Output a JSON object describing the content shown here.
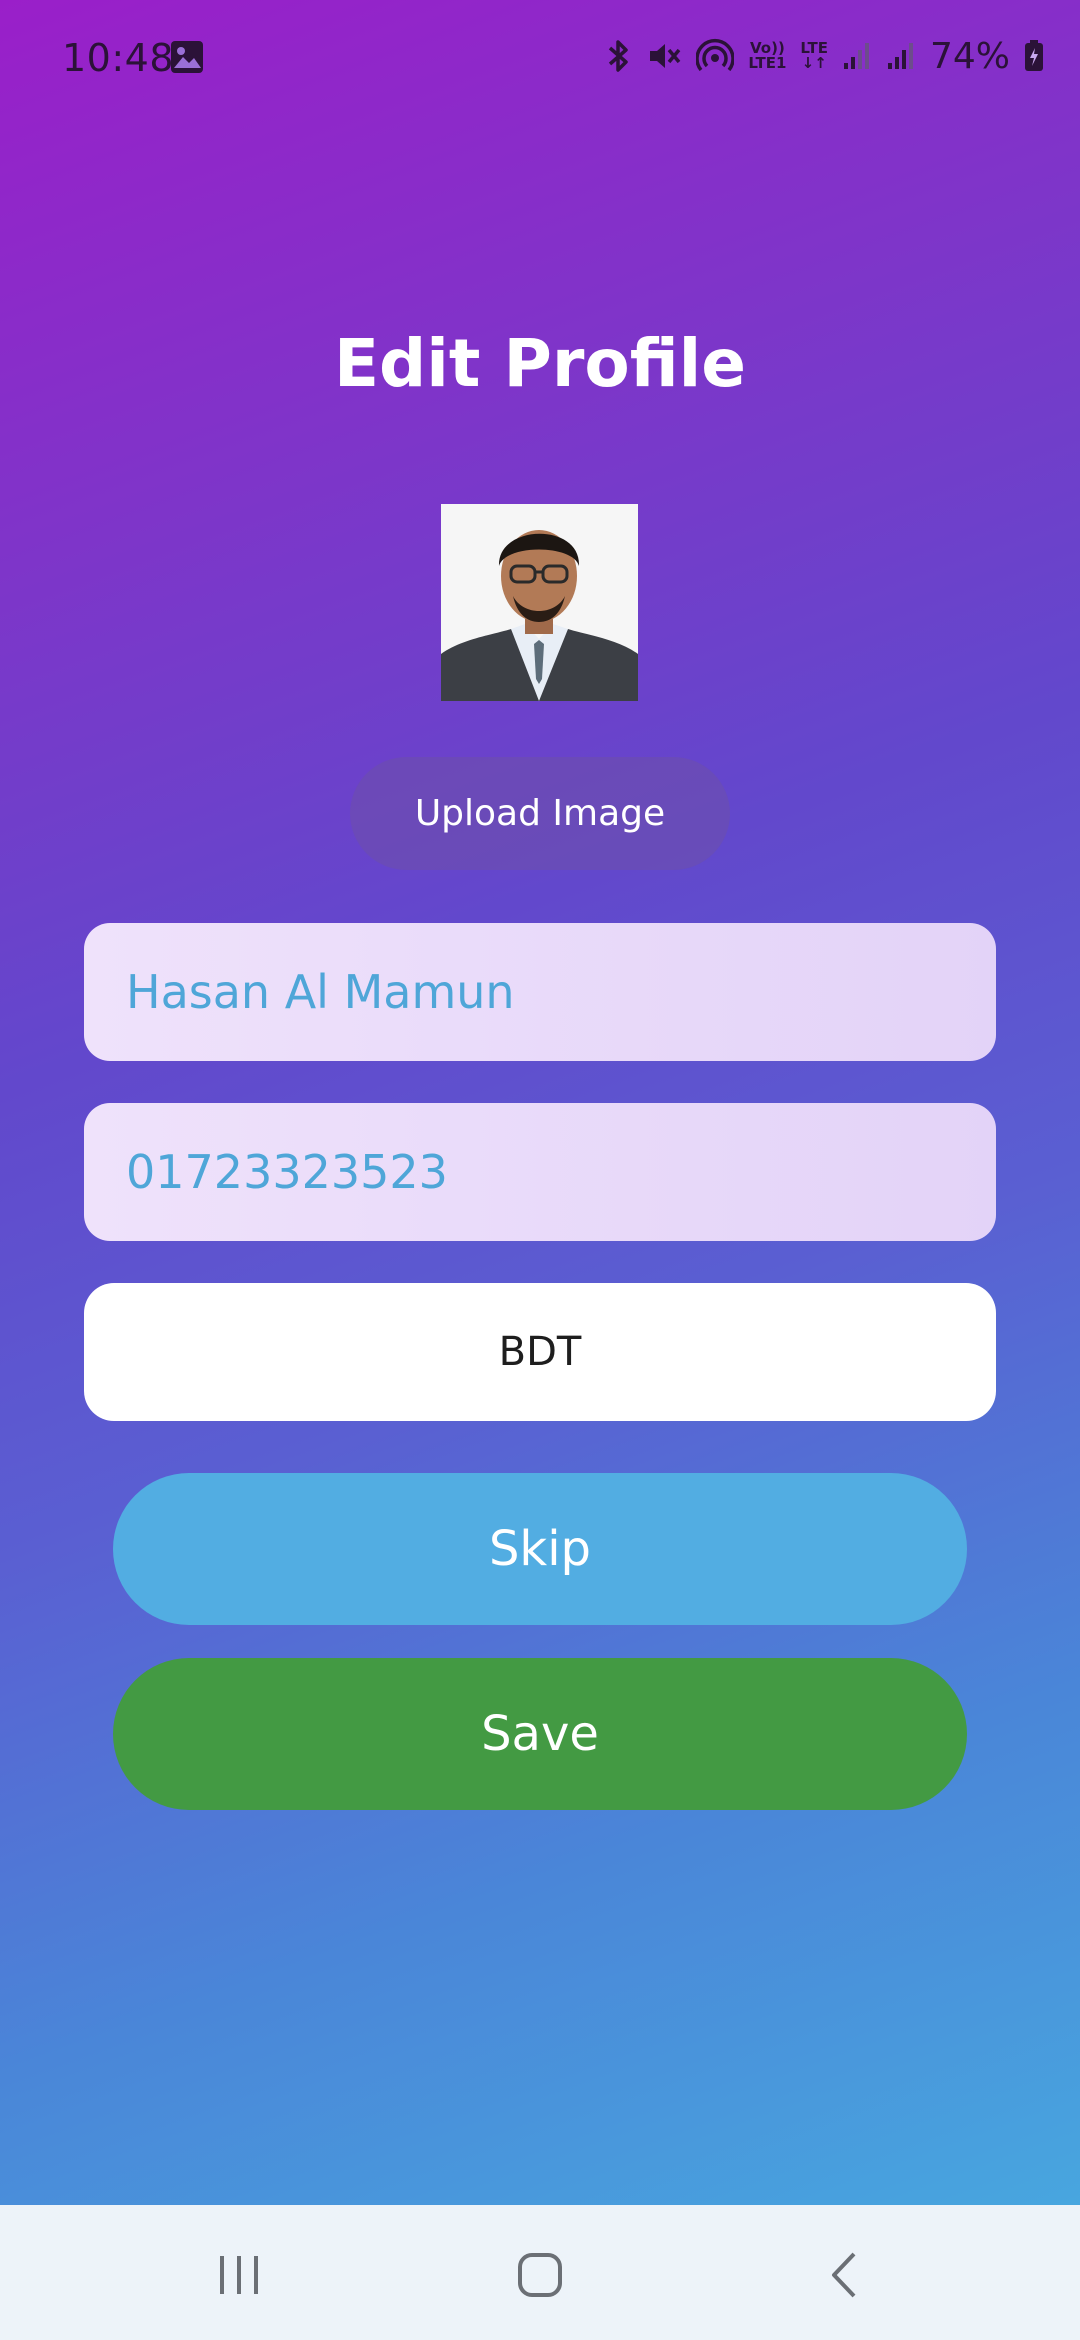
{
  "status_bar": {
    "time": "10:48",
    "volte_line1": "Vo))",
    "volte_line2": "LTE1",
    "lte_label": "LTE",
    "battery": "74%",
    "icons": [
      "gallery-icon",
      "bluetooth-icon",
      "mute-icon",
      "hotspot-icon",
      "volte-icon",
      "lte-data-icon",
      "signal-icon",
      "signal-icon",
      "battery-charging-icon"
    ]
  },
  "page": {
    "title": "Edit Profile"
  },
  "profile": {
    "upload_label": "Upload Image",
    "name_value": "Hasan Al Mamun",
    "phone_value": "01723323523",
    "currency_value": "BDT"
  },
  "actions": {
    "skip_label": "Skip",
    "save_label": "Save"
  },
  "colors": {
    "gradient_top": "#9a1fc9",
    "gradient_bottom": "#48a6df",
    "field_text": "#4fa6d8",
    "skip_button": "#52ade2",
    "save_button": "#439a43",
    "nav_bar": "#edf3f9"
  },
  "nav_bar": {
    "icons": [
      "recents-icon",
      "home-icon",
      "back-icon"
    ]
  }
}
